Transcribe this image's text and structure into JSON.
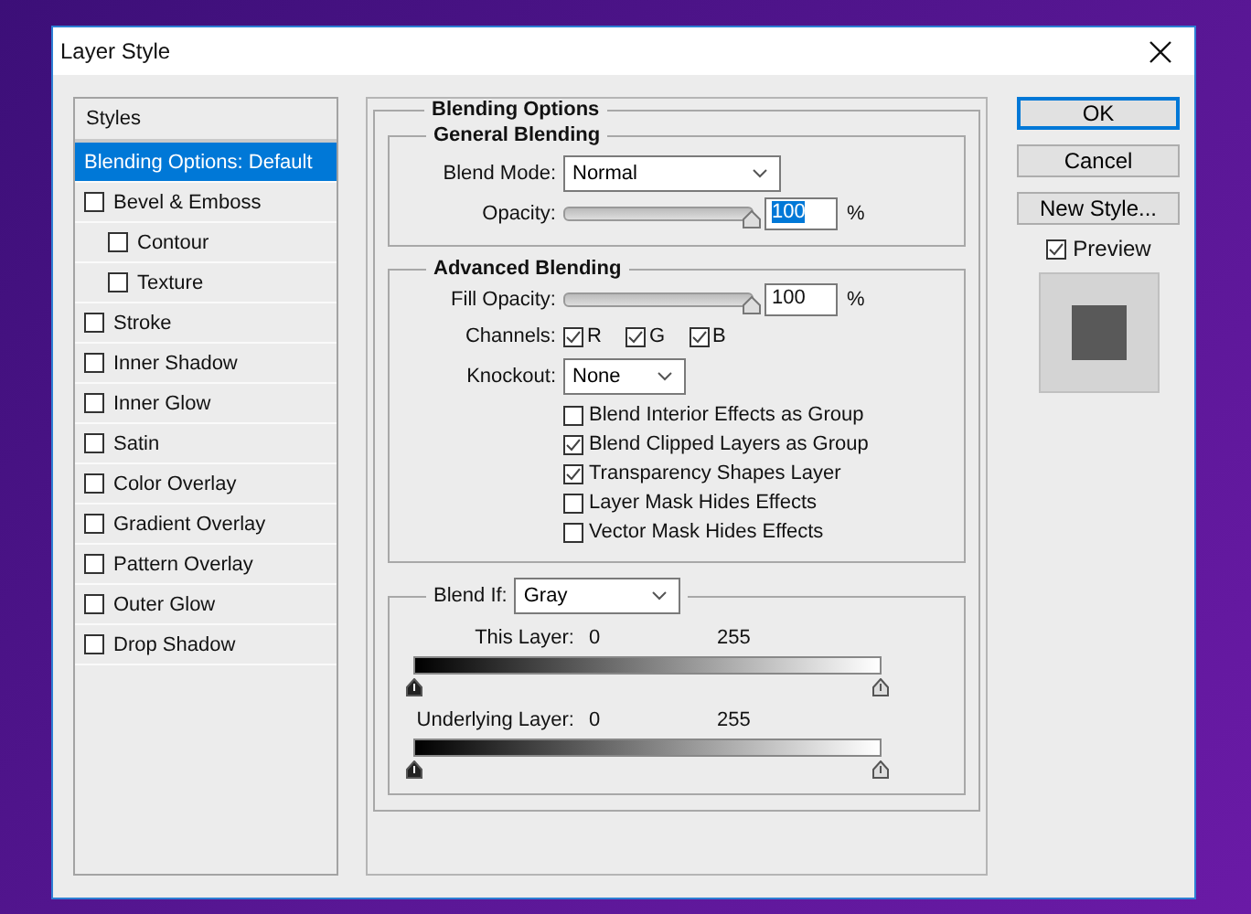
{
  "window": {
    "title": "Layer Style"
  },
  "styles_panel": {
    "header": "Styles",
    "items": [
      {
        "label": "Blending Options: Default",
        "kind": "plain",
        "selected": true
      },
      {
        "label": "Bevel & Emboss",
        "kind": "checkbox",
        "checked": false,
        "selected": false,
        "children": [
          {
            "label": "Contour",
            "kind": "checkbox",
            "checked": false,
            "selected": false
          },
          {
            "label": "Texture",
            "kind": "checkbox",
            "checked": false,
            "selected": false
          }
        ]
      },
      {
        "label": "Stroke",
        "kind": "checkbox",
        "checked": false,
        "selected": false
      },
      {
        "label": "Inner Shadow",
        "kind": "checkbox",
        "checked": false,
        "selected": false
      },
      {
        "label": "Inner Glow",
        "kind": "checkbox",
        "checked": false,
        "selected": false
      },
      {
        "label": "Satin",
        "kind": "checkbox",
        "checked": false,
        "selected": false
      },
      {
        "label": "Color Overlay",
        "kind": "checkbox",
        "checked": false,
        "selected": false
      },
      {
        "label": "Gradient Overlay",
        "kind": "checkbox",
        "checked": false,
        "selected": false
      },
      {
        "label": "Pattern Overlay",
        "kind": "checkbox",
        "checked": false,
        "selected": false
      },
      {
        "label": "Outer Glow",
        "kind": "checkbox",
        "checked": false,
        "selected": false
      },
      {
        "label": "Drop Shadow",
        "kind": "checkbox",
        "checked": false,
        "selected": false
      }
    ]
  },
  "blending_options": {
    "title": "Blending Options",
    "general": {
      "title": "General Blending",
      "blend_mode": {
        "label": "Blend Mode:",
        "value": "Normal"
      },
      "opacity": {
        "label": "Opacity:",
        "level": 1,
        "value": "100",
        "unit": "%",
        "text_selected": true
      }
    },
    "advanced": {
      "title": "Advanced Blending",
      "fill_opacity": {
        "label": "Fill Opacity:",
        "level": 1,
        "value": "100",
        "unit": "%",
        "text_selected": false
      },
      "channels": {
        "label": "Channels:",
        "items": [
          {
            "label": "R",
            "checked": true
          },
          {
            "label": "G",
            "checked": true
          },
          {
            "label": "B",
            "checked": true
          }
        ]
      },
      "knockout": {
        "label": "Knockout:",
        "value": "None"
      },
      "options": [
        {
          "label": "Blend Interior Effects as Group",
          "checked": false
        },
        {
          "label": "Blend Clipped Layers as Group",
          "checked": true
        },
        {
          "label": "Transparency Shapes Layer",
          "checked": true
        },
        {
          "label": "Layer Mask Hides Effects",
          "checked": false
        },
        {
          "label": "Vector Mask Hides Effects",
          "checked": false
        }
      ]
    },
    "blend_if": {
      "label": "Blend If:",
      "value": "Gray",
      "ramps": [
        {
          "label": "This Layer:",
          "low": "0",
          "high": "255"
        },
        {
          "label": "Underlying Layer:",
          "low": "0",
          "high": "255"
        }
      ]
    }
  },
  "buttons": [
    {
      "label": "OK",
      "default": true
    },
    {
      "label": "Cancel",
      "default": false
    },
    {
      "label": "New Style...",
      "default": false
    }
  ],
  "preview": {
    "label": "Preview",
    "checked": true
  }
}
